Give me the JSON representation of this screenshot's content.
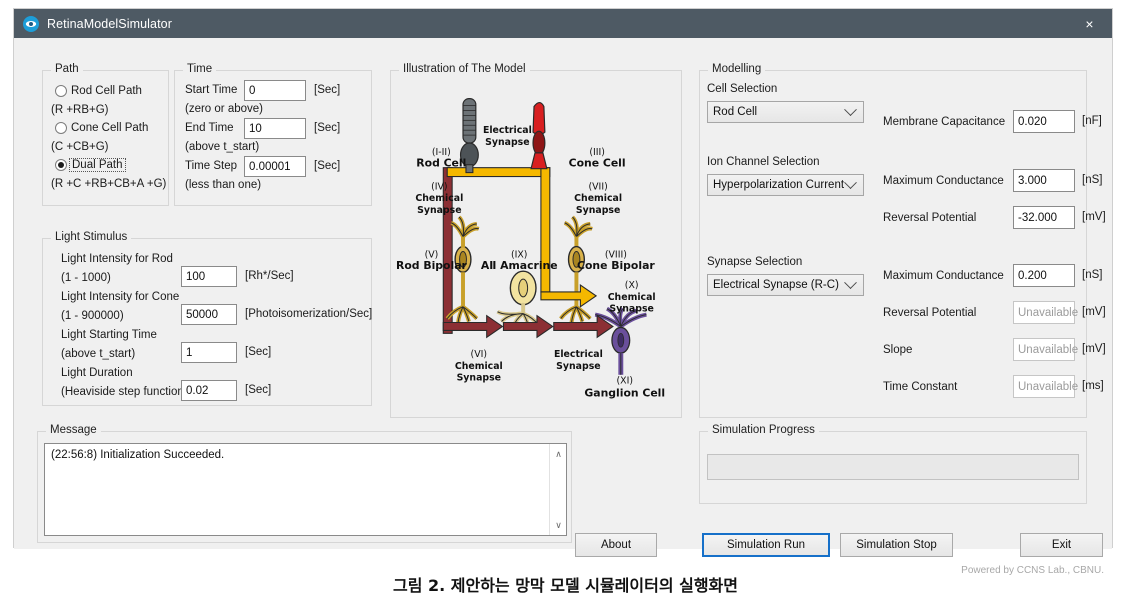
{
  "window": {
    "title": "RetinaModelSimulator",
    "icon": "eye-icon",
    "close_label": "×"
  },
  "path_group": {
    "title": "Path",
    "options": [
      {
        "label": "Rod Cell Path",
        "sub": "(R +RB+G)",
        "selected": false
      },
      {
        "label": "Cone Cell Path",
        "sub": "(C +CB+G)",
        "selected": false
      },
      {
        "label": "Dual Path",
        "sub": "(R +C +RB+CB+A +G)",
        "selected": true
      }
    ]
  },
  "time_group": {
    "title": "Time",
    "fields": [
      {
        "label": "Start Time",
        "value": "0",
        "unit": "[Sec]",
        "hint": "(zero or above)"
      },
      {
        "label": "End Time",
        "value": "10",
        "unit": "[Sec]",
        "hint": "(above t_start)"
      },
      {
        "label": "Time Step",
        "value": "0.00001",
        "unit": "[Sec]",
        "hint": "(less than one)"
      }
    ]
  },
  "light_group": {
    "title": "Light Stimulus",
    "fields": [
      {
        "label": "Light Intensity for Rod",
        "hint": "(1 - 1000)",
        "value": "100",
        "unit": "[Rh*/Sec]"
      },
      {
        "label": "Light Intensity for Cone",
        "hint": "(1 - 900000)",
        "value": "50000",
        "unit": "[Photoisomerization/Sec]"
      },
      {
        "label": "Light Starting Time",
        "hint": "(above t_start)",
        "value": "1",
        "unit": "[Sec]"
      },
      {
        "label": "Light Duration",
        "hint": "(Heaviside step function)",
        "value": "0.02",
        "unit": "[Sec]"
      }
    ]
  },
  "illustration": {
    "title": "Illustration of The Model",
    "labels": {
      "rod_cell": {
        "roman": "(I-II)",
        "name": "Rod Cell"
      },
      "cone_cell": {
        "roman": "(III)",
        "name": "Cone Cell"
      },
      "chem_syn_iv": {
        "roman": "(IV)",
        "l1": "Chemical",
        "l2": "Synapse"
      },
      "chem_syn_vii": {
        "roman": "(VII)",
        "l1": "Chemical",
        "l2": "Synapse"
      },
      "elec_syn_top": {
        "l1": "Electrical",
        "l2": "Synapse"
      },
      "rod_bipolar": {
        "roman": "(V)",
        "name": "Rod Bipolar"
      },
      "cone_bipolar": {
        "roman": "(VIII)",
        "name": "Cone Bipolar"
      },
      "aii_amacrine": {
        "roman": "(IX)",
        "name": "AⅡ Amacrine"
      },
      "chem_syn_vi": {
        "roman": "(VI)",
        "l1": "Chemical",
        "l2": "Synapse"
      },
      "chem_syn_x": {
        "roman": "(X)",
        "l1": "Chemical",
        "l2": "Synapse"
      },
      "elec_syn_bottom": {
        "l1": "Electrical",
        "l2": "Synapse"
      },
      "ganglion": {
        "roman": "(XI)",
        "name": "Ganglion Cell"
      }
    },
    "colors": {
      "dark_red": "#8c2f34",
      "yellow": "#f5b800",
      "gold": "#c8a02a",
      "purple": "#6a4f9b",
      "red": "#d81f20",
      "gray": "#555a5e",
      "pale_yellow": "#f2e3a0",
      "bg": "#efefef"
    }
  },
  "modelling": {
    "title": "Modelling",
    "cell_selection_label": "Cell Selection",
    "cell_selection_value": "Rod Cell",
    "ion_channel_label": "Ion Channel Selection",
    "ion_channel_value": "Hyperpolarization Current",
    "synapse_label": "Synapse Selection",
    "synapse_value": "Electrical Synapse (R-C)",
    "cell_params": [
      {
        "label": "Membrane Capacitance",
        "value": "0.020",
        "unit": "[nF]",
        "disabled": false
      },
      {
        "label": "Maximum Conductance",
        "value": "3.000",
        "unit": "[nS]",
        "disabled": false
      },
      {
        "label": "Reversal Potential",
        "value": "-32.000",
        "unit": "[mV]",
        "disabled": false
      }
    ],
    "synapse_params": [
      {
        "label": "Maximum Conductance",
        "value": "0.200",
        "unit": "[nS]",
        "disabled": false
      },
      {
        "label": "Reversal Potential",
        "value": "Unavailable",
        "unit": "[mV]",
        "disabled": true
      },
      {
        "label": "Slope",
        "value": "Unavailable",
        "unit": "[mV]",
        "disabled": true
      },
      {
        "label": "Time Constant",
        "value": "Unavailable",
        "unit": "[ms]",
        "disabled": true
      }
    ]
  },
  "message_group": {
    "title": "Message",
    "text": "(22:56:8) Initialization Succeeded.",
    "scroll_up": "∧",
    "scroll_down": "∨"
  },
  "progress_group": {
    "title": "Simulation Progress",
    "value": ""
  },
  "buttons": {
    "about": "About",
    "run": "Simulation Run",
    "stop": "Simulation Stop",
    "exit": "Exit"
  },
  "footer": {
    "powered": "Powered by CCNS Lab., CBNU."
  },
  "caption": "그림 2. 제안하는 망막 모델 시뮬레이터의 실행화면"
}
